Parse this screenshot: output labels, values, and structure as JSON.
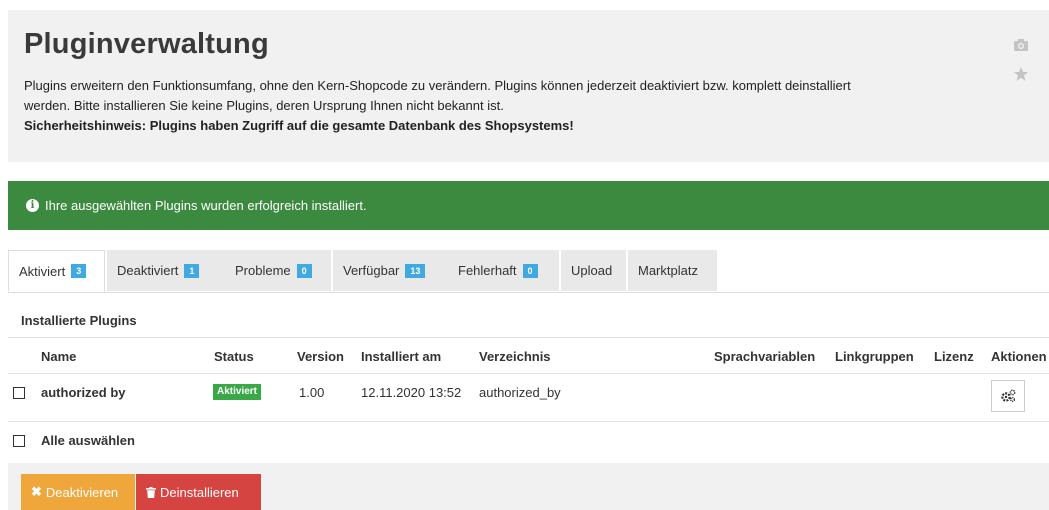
{
  "header": {
    "title": "Pluginverwaltung",
    "desc_line1": "Plugins erweitern den Funktionsumfang, ohne den Kern-Shopcode zu verändern. Plugins können jederzeit deaktiviert bzw. komplett deinstalliert",
    "desc_line2": "werden. Bitte installieren Sie keine Plugins, deren Ursprung Ihnen nicht bekannt ist.",
    "warning": "Sicherheitshinweis: Plugins haben Zugriff auf die gesamte Datenbank des Shopsystems!",
    "icons": [
      "camera-icon",
      "star-icon"
    ]
  },
  "alert": {
    "icon": "info-icon",
    "text": "Ihre ausgewählten Plugins wurden erfolgreich installiert."
  },
  "tabs": [
    {
      "label": "Aktiviert",
      "count": "3"
    },
    {
      "label": "Deaktiviert",
      "count": "1"
    },
    {
      "label": "Probleme",
      "count": "0"
    },
    {
      "label": "Verfügbar",
      "count": "13"
    },
    {
      "label": "Fehlerhaft",
      "count": "0"
    },
    {
      "label": "Upload"
    },
    {
      "label": "Marktplatz"
    }
  ],
  "section_title": "Installierte Plugins",
  "table": {
    "headers": {
      "name": "Name",
      "status": "Status",
      "version": "Version",
      "installed": "Installiert am",
      "directory": "Verzeichnis",
      "langvars": "Sprachvariablen",
      "linkgroups": "Linkgruppen",
      "license": "Lizenz",
      "actions": "Aktionen"
    },
    "rows": [
      {
        "name": "authorized by",
        "status": "Aktiviert",
        "version": "1.00",
        "installed": "12.11.2020 13:52",
        "directory": "authorized_by"
      }
    ],
    "select_all": "Alle auswählen"
  },
  "buttons": {
    "deactivate": "Deaktivieren",
    "uninstall": "Deinstallieren"
  },
  "colors": {
    "success": "#3c8a3f",
    "badge": "#3fa9e0",
    "status_active": "#3aa848",
    "deactivate": "#efa73c",
    "uninstall": "#d64441"
  }
}
